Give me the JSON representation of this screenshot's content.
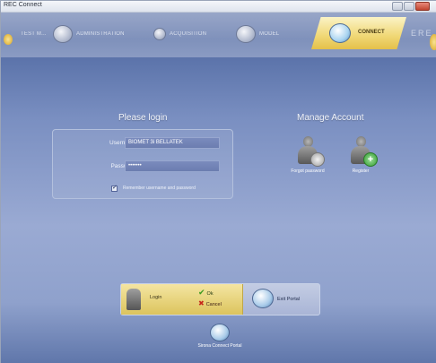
{
  "window": {
    "title": "REC Connect"
  },
  "nav": {
    "items": [
      {
        "id": "test",
        "label": "TEST M..."
      },
      {
        "id": "administration",
        "label": "ADMINISTRATION"
      },
      {
        "id": "acquisition",
        "label": "ACQUISITION"
      },
      {
        "id": "model",
        "label": "MODEL"
      },
      {
        "id": "connect",
        "label": "CONNECT"
      }
    ],
    "right_mark": "ERE"
  },
  "login": {
    "title": "Please login",
    "username_label": "Username",
    "username_value": "BIOMET 3i BELLATEK",
    "password_label": "Password",
    "password_value": "•••••••",
    "remember_label": "Remember username and password",
    "remember_checked": true
  },
  "account": {
    "title": "Manage Account",
    "forgot_label": "Forgot password",
    "register_label": "Register"
  },
  "actions": {
    "login_label": "Login",
    "ok_label": "Ok",
    "cancel_label": "Cancel",
    "exit_label": "Exit Portal"
  },
  "portal": {
    "label": "Sirona Connect Portal"
  },
  "colors": {
    "accent": "#e4c04a",
    "background": "#8a9ccb"
  }
}
